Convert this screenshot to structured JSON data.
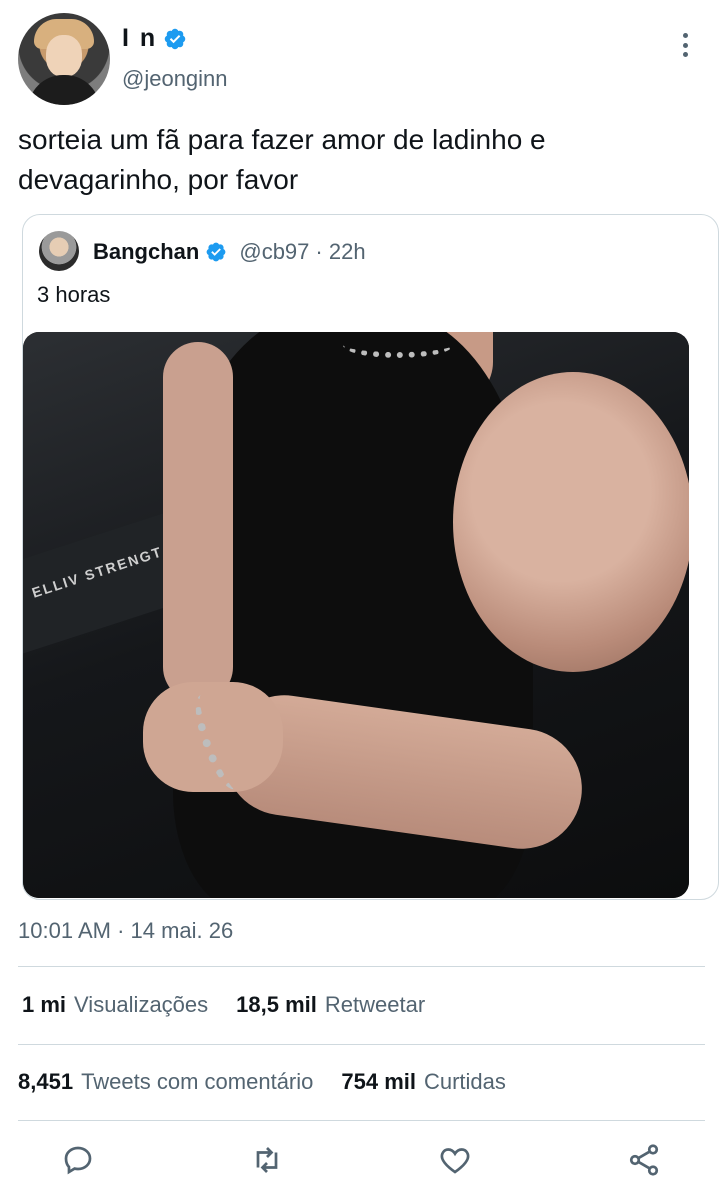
{
  "tweet": {
    "author": {
      "display_name": "I n",
      "handle": "@jeonginn",
      "verified": true
    },
    "text": "sorteia um fã para fazer amor de ladinho e devagarinho, por favor",
    "timestamp": "10:01 AM · 14 mai. 26"
  },
  "quote": {
    "author": {
      "display_name": "Bangchan",
      "handle": "@cb97",
      "time": "· 22h",
      "verified": true
    },
    "text": "3 horas",
    "media_overlay_text": "ELLIV STRENGT"
  },
  "stats": {
    "views": {
      "value": "1 mi",
      "label": "Visualizações"
    },
    "retweets": {
      "value": "18,5 mil",
      "label": "Retweetar"
    },
    "replies": {
      "value": "8,451",
      "label": "Tweets com comentário"
    },
    "likes": {
      "value": "754 mil",
      "label": "Curtidas"
    }
  },
  "actions": {
    "icons": [
      "reply-icon",
      "retweet-icon",
      "like-icon",
      "share-icon"
    ]
  },
  "colors": {
    "verified": "#1d9bf0",
    "text_secondary": "#536471",
    "separator": "#cfd9de"
  }
}
